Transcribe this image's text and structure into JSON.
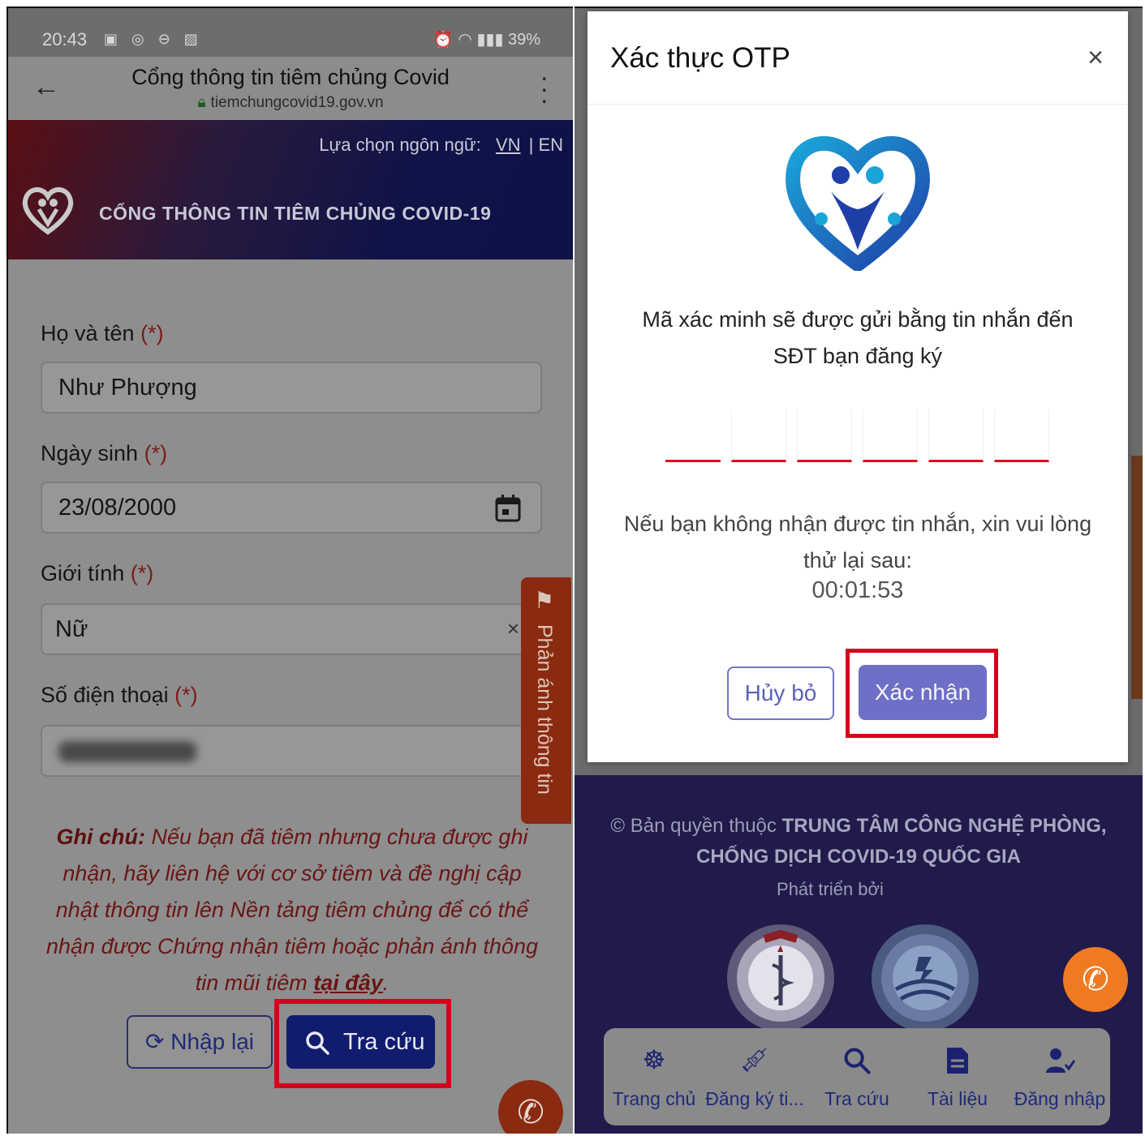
{
  "left": {
    "status": {
      "time": "20:43",
      "left_icons": "▣ ◎ ⊖ ▨",
      "right_icons": "⏰ ◠ ▮▮▮",
      "battery": "39%"
    },
    "browser": {
      "title": "Cổng thông tin tiêm chủng Covid",
      "url": "tiemchungcovid19.gov.vn"
    },
    "header": {
      "lang_label": "Lựa chọn ngôn ngữ:",
      "lang_vn": "VN",
      "lang_sep": "|",
      "lang_en": "EN",
      "site_title": "CỔNG THÔNG TIN TIÊM CHỦNG COVID-19"
    },
    "form": {
      "name_label": "Họ và tên",
      "name_value": "Như Phượng",
      "dob_label": "Ngày sinh",
      "dob_value": "23/08/2000",
      "gender_label": "Giới tính",
      "gender_value": "Nữ",
      "phone_label": "Số điện thoại",
      "required_mark": "(*)"
    },
    "note": {
      "title": "Ghi chú:",
      "text": " Nếu bạn đã tiêm nhưng chưa được ghi nhận, hãy liên hệ với cơ sở tiêm và đề nghị cập nhật thông tin lên Nền tảng tiêm chủng để có thể nhận được Chứng nhận tiêm hoặc phản ánh thông tin mũi tiêm ",
      "link": "tại đây",
      "end": "."
    },
    "buttons": {
      "reset": "Nhập lại",
      "search": "Tra cứu"
    },
    "feedback_tab": "Phản ánh thông tin"
  },
  "modal": {
    "title": "Xác thực OTP",
    "close": "×",
    "desc_line1": "Mã xác minh sẽ được gửi bằng tin nhắn đến",
    "desc_line2": "SĐT bạn đăng ký",
    "retry_line1": "Nếu bạn không nhận được tin nhắn, xin vui lòng",
    "retry_line2": "thử lại sau:",
    "timer": "00:01:53",
    "cancel": "Hủy bỏ",
    "confirm": "Xác nhận"
  },
  "footer": {
    "copyright_prefix": "© Bản quyền thuộc ",
    "copyright_org_1": "TRUNG TÂM CÔNG NGHỆ PHÒNG,",
    "copyright_org_2": "CHỐNG DỊCH COVID-19 QUỐC GIA",
    "developed_by": "Phát triển bởi "
  },
  "nav": [
    {
      "label": "Trang chủ",
      "icon": "ship-wheel-icon"
    },
    {
      "label": "Đăng ký ti...",
      "icon": "vaccine-icon"
    },
    {
      "label": "Tra cứu",
      "icon": "search-icon"
    },
    {
      "label": "Tài liệu",
      "icon": "document-icon"
    },
    {
      "label": "Đăng nhập",
      "icon": "user-check-icon"
    }
  ],
  "colors": {
    "highlight": "#d7001c",
    "primary": "#111c6e",
    "modal_button": "#6e6fc7",
    "otp_underline": "#e0101e",
    "call_button": "#f07a22"
  }
}
